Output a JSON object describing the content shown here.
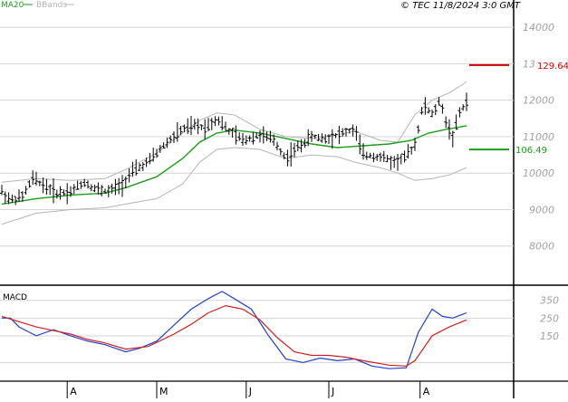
{
  "header": {
    "ma_label": "MA20",
    "bb_label": "BBands",
    "copyright": "© TEC 11/8/2024 3:0 GMT"
  },
  "colors": {
    "price_bars": "#000000",
    "ma20": "#1a9e1a",
    "bbands": "#b4b4b4",
    "resistance": "#cc0000",
    "support": "#1a9e1a",
    "macd_line": "#1f3fd0",
    "signal_line": "#d01f1f",
    "gridline": "#d4d4d4",
    "axis": "#000000"
  },
  "chart_data": [
    {
      "type": "ohlc",
      "panel": "price",
      "y_ticks": [
        8000,
        9000,
        10000,
        11000,
        12000,
        13000,
        14000
      ],
      "y_tick_labels": [
        "8000",
        "9000",
        "10000",
        "11000",
        "12000",
        "13000",
        "14000"
      ],
      "ylim": [
        7000,
        14500
      ],
      "grid": true,
      "x_months": [
        "A",
        "M",
        "J",
        "J",
        "A"
      ],
      "price_path": [
        [
          0,
          9500
        ],
        [
          5,
          9250
        ],
        [
          12,
          9350
        ],
        [
          18,
          9850
        ],
        [
          25,
          9650
        ],
        [
          32,
          9450
        ],
        [
          40,
          9500
        ],
        [
          48,
          9750
        ],
        [
          55,
          9550
        ],
        [
          62,
          9500
        ],
        [
          70,
          9700
        ],
        [
          75,
          10000
        ],
        [
          85,
          10300
        ],
        [
          95,
          10800
        ],
        [
          105,
          11200
        ],
        [
          112,
          11300
        ],
        [
          118,
          11250
        ],
        [
          125,
          11500
        ],
        [
          132,
          11150
        ],
        [
          140,
          10900
        ],
        [
          150,
          11050
        ],
        [
          158,
          10900
        ],
        [
          165,
          10400
        ],
        [
          172,
          10700
        ],
        [
          180,
          11000
        ],
        [
          188,
          10950
        ],
        [
          195,
          11050
        ],
        [
          205,
          11200
        ],
        [
          210,
          10500
        ],
        [
          220,
          10450
        ],
        [
          228,
          10300
        ],
        [
          235,
          10450
        ],
        [
          240,
          10800
        ],
        [
          245,
          11900
        ],
        [
          250,
          11600
        ],
        [
          255,
          12000
        ],
        [
          258,
          11400
        ],
        [
          262,
          11000
        ],
        [
          266,
          11650
        ],
        [
          270,
          11950
        ]
      ],
      "ma20_path": [
        [
          0,
          9150
        ],
        [
          20,
          9300
        ],
        [
          40,
          9400
        ],
        [
          60,
          9450
        ],
        [
          72,
          9600
        ],
        [
          90,
          9900
        ],
        [
          105,
          10400
        ],
        [
          115,
          10850
        ],
        [
          125,
          11100
        ],
        [
          135,
          11180
        ],
        [
          150,
          11100
        ],
        [
          165,
          10950
        ],
        [
          180,
          10800
        ],
        [
          195,
          10700
        ],
        [
          210,
          10750
        ],
        [
          225,
          10800
        ],
        [
          238,
          10900
        ],
        [
          248,
          11100
        ],
        [
          258,
          11200
        ],
        [
          270,
          11300
        ]
      ],
      "bb_upper_path": [
        [
          0,
          9750
        ],
        [
          20,
          9850
        ],
        [
          40,
          9800
        ],
        [
          60,
          9850
        ],
        [
          72,
          10100
        ],
        [
          90,
          10550
        ],
        [
          105,
          11100
        ],
        [
          115,
          11450
        ],
        [
          125,
          11650
        ],
        [
          135,
          11600
        ],
        [
          150,
          11200
        ],
        [
          165,
          11000
        ],
        [
          180,
          10950
        ],
        [
          195,
          11050
        ],
        [
          205,
          11150
        ],
        [
          220,
          10900
        ],
        [
          230,
          10850
        ],
        [
          240,
          11600
        ],
        [
          250,
          12000
        ],
        [
          260,
          12200
        ],
        [
          270,
          12500
        ]
      ],
      "bb_lower_path": [
        [
          0,
          8600
        ],
        [
          20,
          8900
        ],
        [
          40,
          9000
        ],
        [
          60,
          9050
        ],
        [
          72,
          9150
        ],
        [
          90,
          9300
        ],
        [
          105,
          9700
        ],
        [
          115,
          10300
        ],
        [
          125,
          10650
        ],
        [
          135,
          10700
        ],
        [
          150,
          10650
        ],
        [
          165,
          10400
        ],
        [
          180,
          10500
        ],
        [
          195,
          10450
        ],
        [
          205,
          10300
        ],
        [
          220,
          10150
        ],
        [
          230,
          10000
        ],
        [
          240,
          9800
        ],
        [
          250,
          9850
        ],
        [
          260,
          9950
        ],
        [
          270,
          10150
        ]
      ],
      "resistance": {
        "label": "129.64",
        "value": 12964
      },
      "support": {
        "label": "106.49",
        "value": 10649
      }
    },
    {
      "type": "line",
      "panel": "macd",
      "title": "MACD",
      "y_ticks": [
        150,
        250,
        350
      ],
      "y_tick_labels": [
        "150",
        "250",
        "350"
      ],
      "ylim": [
        -90,
        420
      ],
      "grid": true,
      "series": [
        {
          "color": "macd",
          "values": [
            [
              0,
              250
            ],
            [
              5,
              250
            ],
            [
              10,
              200
            ],
            [
              20,
              150
            ],
            [
              30,
              185
            ],
            [
              40,
              150
            ],
            [
              50,
              120
            ],
            [
              60,
              100
            ],
            [
              72,
              60
            ],
            [
              80,
              80
            ],
            [
              90,
              120
            ],
            [
              100,
              210
            ],
            [
              110,
              300
            ],
            [
              120,
              360
            ],
            [
              128,
              400
            ],
            [
              135,
              360
            ],
            [
              145,
              300
            ],
            [
              155,
              150
            ],
            [
              165,
              20
            ],
            [
              175,
              0
            ],
            [
              185,
              25
            ],
            [
              195,
              10
            ],
            [
              205,
              20
            ],
            [
              215,
              -20
            ],
            [
              225,
              -35
            ],
            [
              235,
              -30
            ],
            [
              242,
              170
            ],
            [
              250,
              300
            ],
            [
              256,
              260
            ],
            [
              262,
              250
            ],
            [
              270,
              280
            ]
          ]
        },
        {
          "color": "signal",
          "values": [
            [
              0,
              260
            ],
            [
              10,
              230
            ],
            [
              20,
              200
            ],
            [
              30,
              180
            ],
            [
              40,
              160
            ],
            [
              50,
              130
            ],
            [
              60,
              110
            ],
            [
              72,
              75
            ],
            [
              85,
              90
            ],
            [
              100,
              160
            ],
            [
              110,
              215
            ],
            [
              120,
              280
            ],
            [
              130,
              320
            ],
            [
              140,
              300
            ],
            [
              150,
              240
            ],
            [
              160,
              140
            ],
            [
              170,
              60
            ],
            [
              180,
              40
            ],
            [
              190,
              40
            ],
            [
              200,
              30
            ],
            [
              210,
              10
            ],
            [
              225,
              -15
            ],
            [
              235,
              -20
            ],
            [
              240,
              10
            ],
            [
              250,
              150
            ],
            [
              260,
              200
            ],
            [
              270,
              240
            ]
          ]
        }
      ]
    }
  ]
}
